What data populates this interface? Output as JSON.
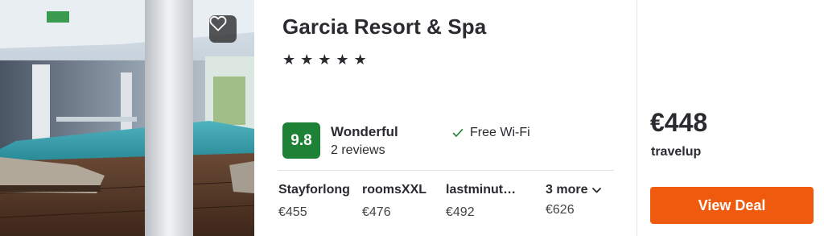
{
  "hotel": {
    "name": "Garcia Resort & Spa",
    "stars": [
      "★",
      "★",
      "★",
      "★",
      "★"
    ],
    "rating": {
      "score": "9.8",
      "label": "Wonderful",
      "reviews": "2 reviews",
      "color": "#1d8235"
    },
    "amenities": [
      "Free Wi-Fi"
    ]
  },
  "offers": [
    {
      "provider": "Stayforlong",
      "price": "€455"
    },
    {
      "provider": "roomsXXL",
      "price": "€476"
    },
    {
      "provider": "lastminut…",
      "price": "€492"
    }
  ],
  "more_offers": {
    "label": "3 more",
    "price": "€626"
  },
  "best_deal": {
    "price": "€448",
    "provider": "travelup",
    "button_label": "View Deal",
    "button_color": "#f05a0f"
  },
  "icons": {
    "favorite": "heart-icon",
    "amenity": "checkmark-icon",
    "expand": "chevron-down-icon"
  }
}
